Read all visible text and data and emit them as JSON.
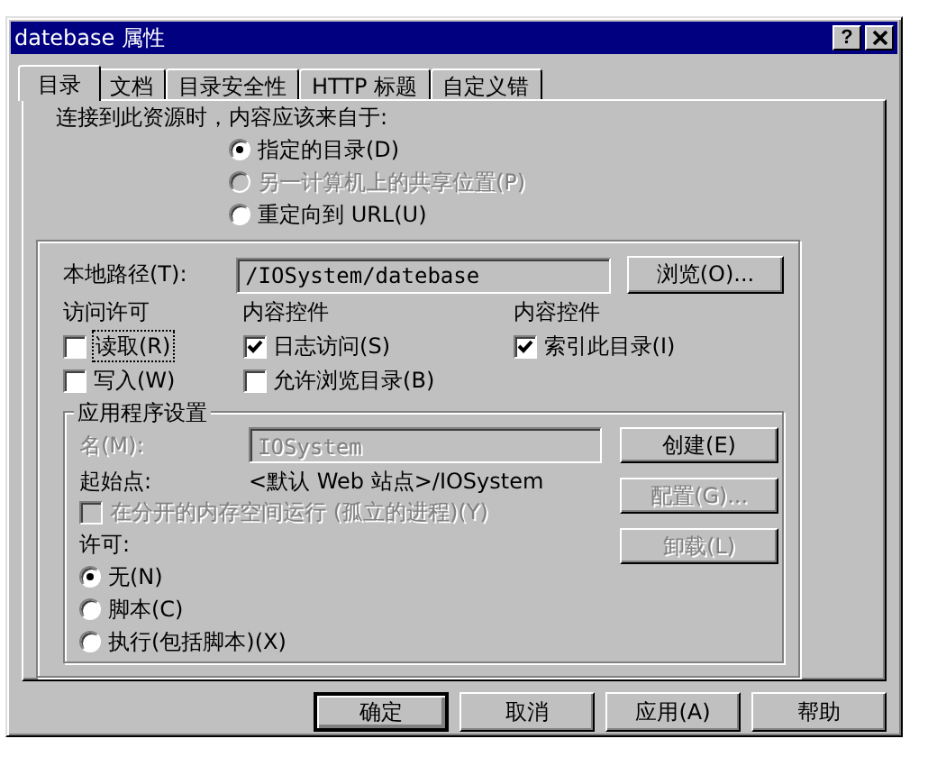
{
  "window": {
    "title": "datebase 属性",
    "help_button": "?"
  },
  "tabs": [
    {
      "label": "目录",
      "selected": true
    },
    {
      "label": "文档",
      "selected": false
    },
    {
      "label": "目录安全性",
      "selected": false
    },
    {
      "label": "HTTP 标题",
      "selected": false
    },
    {
      "label": "自定义错",
      "selected": false
    }
  ],
  "source": {
    "prompt": "连接到此资源时，内容应该来自于:",
    "options": [
      {
        "label": "指定的目录(D)",
        "selected": true,
        "disabled": false
      },
      {
        "label": "另一计算机上的共享位置(P)",
        "selected": false,
        "disabled": true
      },
      {
        "label": "重定向到 URL(U)",
        "selected": false,
        "disabled": false
      }
    ]
  },
  "local_path": {
    "label": "本地路径(T):",
    "value": "/IOSystem/datebase",
    "browse_button": "浏览(O)..."
  },
  "check_groups": [
    {
      "heading": "访问许可",
      "items": [
        {
          "label": "读取(R)",
          "checked": false,
          "focused": true
        },
        {
          "label": "写入(W)",
          "checked": false,
          "focused": false
        }
      ]
    },
    {
      "heading": "内容控件",
      "items": [
        {
          "label": "日志访问(S)",
          "checked": true,
          "focused": false
        },
        {
          "label": "允许浏览目录(B)",
          "checked": false,
          "focused": false
        }
      ]
    },
    {
      "heading": "内容控件",
      "items": [
        {
          "label": "索引此目录(I)",
          "checked": true,
          "focused": false
        }
      ]
    }
  ],
  "app_settings": {
    "title": "应用程序设置",
    "name": {
      "label": "名(M):",
      "value": "IOSystem",
      "disabled": true
    },
    "start_point": {
      "label": "起始点:",
      "value": "<默认 Web 站点>/IOSystem"
    },
    "isolated": {
      "label": "在分开的内存空间运行 (孤立的进程)(Y)",
      "checked": false,
      "disabled": true
    },
    "permissions": {
      "label": "许可:",
      "options": [
        {
          "label": "无(N)",
          "selected": true
        },
        {
          "label": "脚本(C)",
          "selected": false
        },
        {
          "label": "执行(包括脚本)(X)",
          "selected": false
        }
      ]
    },
    "buttons": [
      {
        "label": "创建(E)",
        "disabled": false
      },
      {
        "label": "配置(G)...",
        "disabled": true
      },
      {
        "label": "卸载(L)",
        "disabled": true
      }
    ]
  },
  "buttons": [
    {
      "label": "确定",
      "default": true
    },
    {
      "label": "取消",
      "default": false
    },
    {
      "label": "应用(A)",
      "default": false
    },
    {
      "label": "帮助",
      "default": false
    }
  ]
}
